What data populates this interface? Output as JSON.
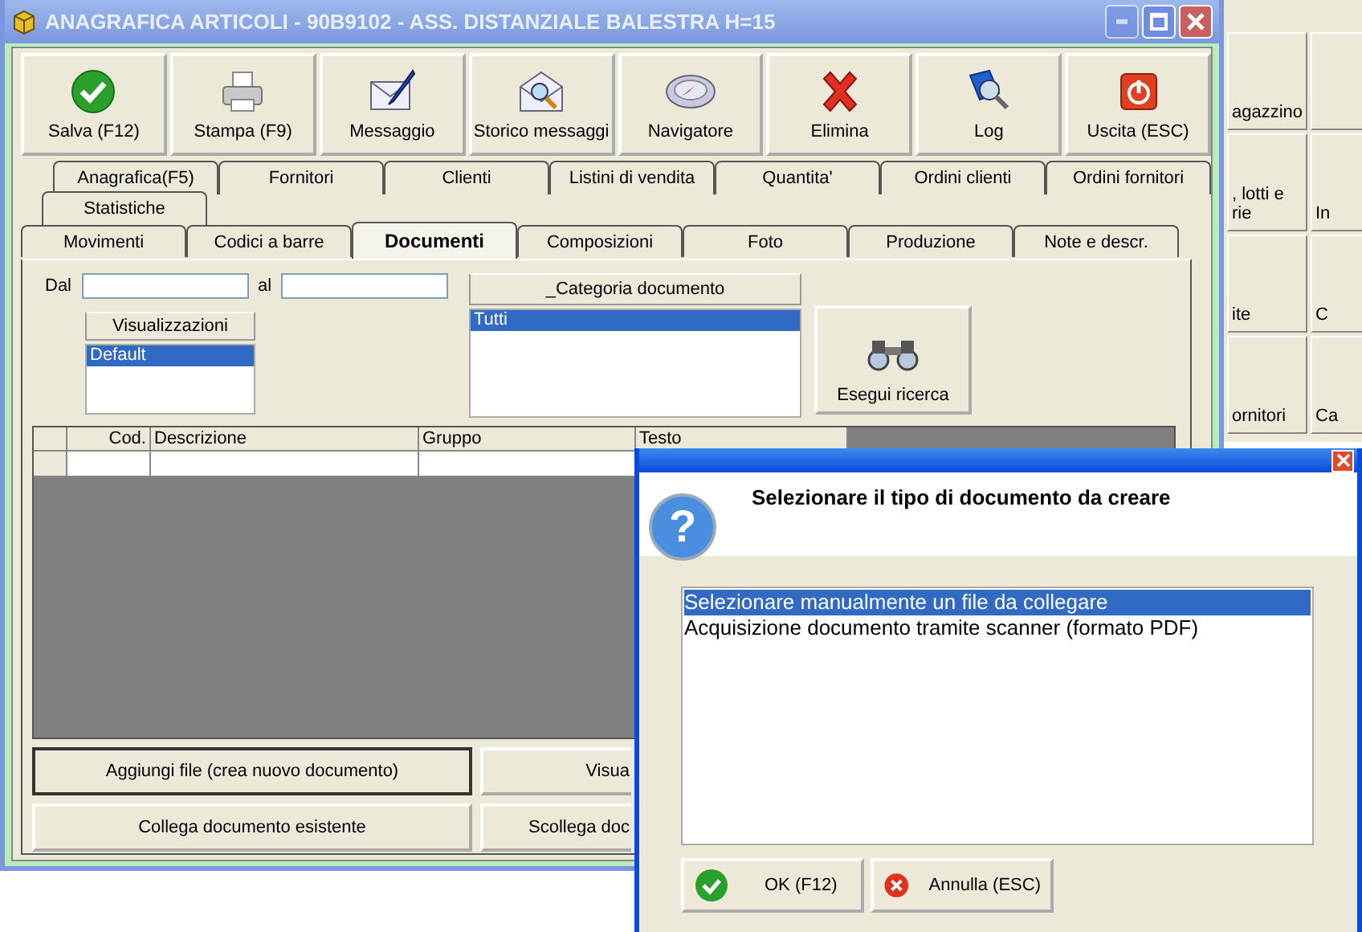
{
  "background_window": {
    "tiles": [
      {
        "kind": "text",
        "lines": [
          "agazzino"
        ]
      },
      {
        "kind": "blank"
      },
      {
        "kind": "text",
        "lines": [
          ", lotti e",
          "rie"
        ]
      },
      {
        "kind": "text",
        "lines": [
          "In"
        ]
      },
      {
        "kind": "text",
        "lines": [
          "ite"
        ]
      },
      {
        "kind": "text",
        "lines": [
          "C"
        ]
      },
      {
        "kind": "text",
        "lines": [
          "ornitori"
        ]
      },
      {
        "kind": "text",
        "lines": [
          "Ca"
        ]
      }
    ]
  },
  "main_window": {
    "title": "ANAGRAFICA ARTICOLI - 90B9102 - ASS. DISTANZIALE BALESTRA H=15",
    "active": false,
    "toolbar": [
      "Salva (F12)",
      "Stampa (F9)",
      "Messaggio",
      "Storico messaggi",
      "Navigatore",
      "Elimina",
      "Log",
      "Uscita (ESC)"
    ],
    "tab_rows": [
      {
        "tabs": [
          {
            "label": "Anagrafica(F5)",
            "selected": false
          },
          {
            "label": "Fornitori",
            "selected": false
          },
          {
            "label": "Clienti",
            "selected": false
          },
          {
            "label": "Listini di vendita",
            "selected": false
          },
          {
            "label": "Quantita'",
            "selected": false
          },
          {
            "label": "Ordini clienti",
            "selected": false
          },
          {
            "label": "Ordini fornitori",
            "selected": false
          }
        ]
      },
      {
        "tabs": [
          {
            "label": "Statistiche",
            "selected": false
          }
        ]
      },
      {
        "tabs": [
          {
            "label": "Movimenti",
            "selected": false
          },
          {
            "label": "Codici a barre",
            "selected": false
          },
          {
            "label": "Documenti",
            "selected": true
          },
          {
            "label": "Composizioni",
            "selected": false
          },
          {
            "label": "Foto",
            "selected": false
          },
          {
            "label": "Produzione",
            "selected": false
          },
          {
            "label": "Note e descr.",
            "selected": false
          }
        ]
      }
    ],
    "filters": {
      "from_label": "Dal",
      "to_label": "al"
    },
    "views": {
      "header": "Visualizzazioni",
      "items": [
        {
          "label": "Default",
          "selected": true
        }
      ]
    },
    "category": {
      "header": "_Categoria documento",
      "items": [
        {
          "label": "Tutti",
          "selected": true
        }
      ]
    },
    "search_button": "Esegui ricerca",
    "grid": {
      "columns": [
        "Cod.",
        "Descrizione",
        "Gruppo",
        "Testo"
      ]
    },
    "buttons": [
      {
        "label": "Aggiungi file (crea nuovo documento)",
        "default": true
      },
      {
        "label": "Visua",
        "default": false
      },
      {
        "label": "Collega documento esistente",
        "default": false
      },
      {
        "label": "Scollega doc",
        "default": false
      }
    ]
  },
  "dialog": {
    "active": true,
    "icon_glyph": "?",
    "heading": "Selezionare il tipo di documento da creare",
    "options": [
      {
        "label": "Selezionare manualmente un file da collegare",
        "selected": true
      },
      {
        "label": "Acquisizione documento tramite scanner (formato PDF)",
        "selected": false
      }
    ],
    "buttons": [
      "OK (F12)",
      "Annulla (ESC)"
    ]
  }
}
